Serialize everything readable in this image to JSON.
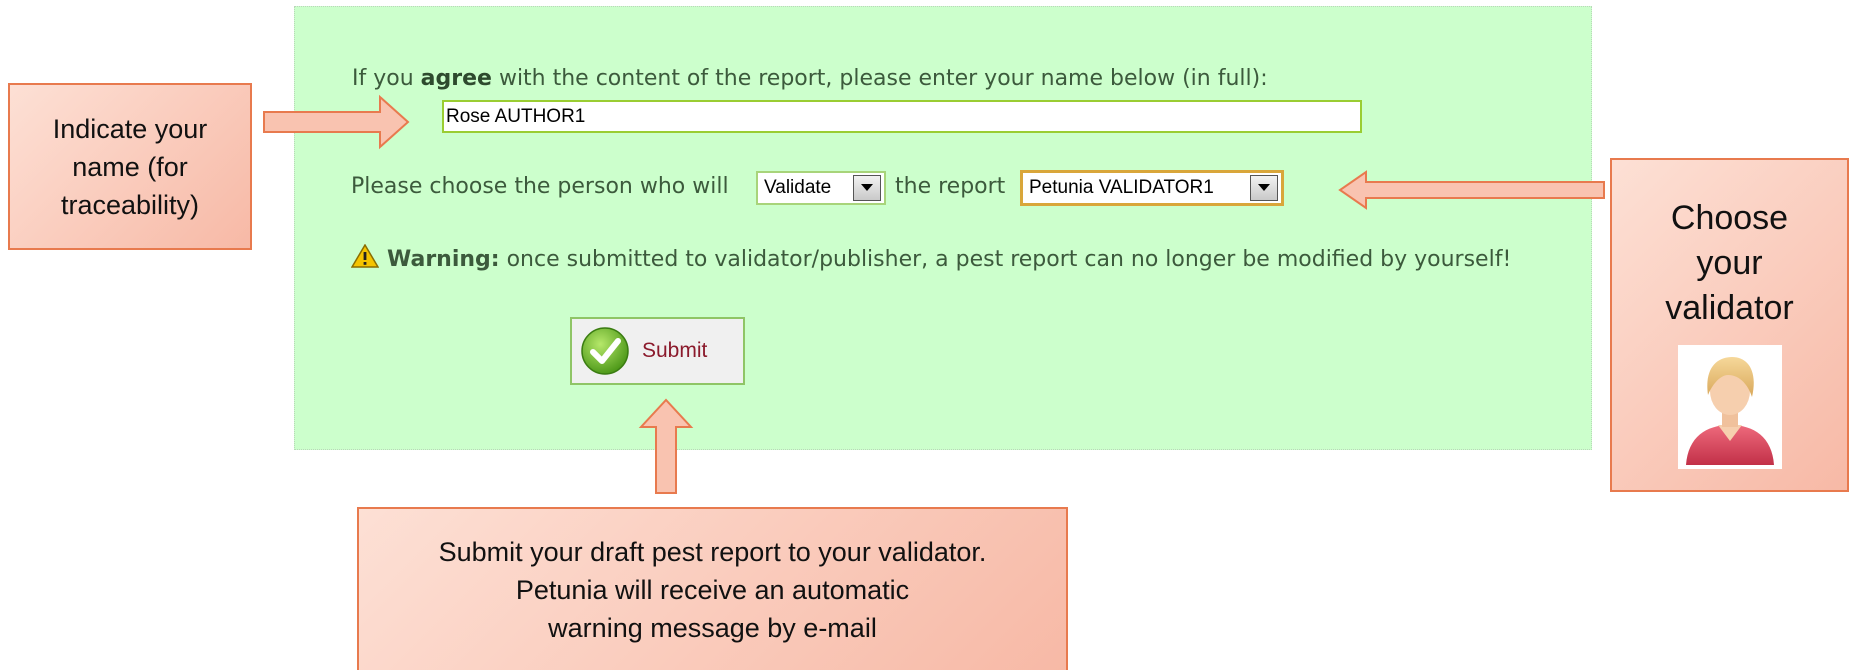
{
  "form": {
    "agree_prefix": "If you ",
    "agree_bold": "agree",
    "agree_suffix": " with the content of the report, please enter your name below (in full):",
    "name_value": "Rose AUTHOR1",
    "choose_prefix": "Please choose the person who will",
    "action_selected": "Validate",
    "choose_middle": "the report",
    "person_selected": "Petunia VALIDATOR1",
    "warning_label": "Warning:",
    "warning_text": " once submitted to validator/publisher, a pest report can no longer be modified by yourself!",
    "submit_label": "Submit"
  },
  "callouts": {
    "name_hint": "Indicate your\nname (for\ntraceability)",
    "validator_hint": "Choose\nyour\nvalidator",
    "submit_hint": "Submit your draft pest report to your validator.\nPetunia will receive an automatic\nwarning message by e-mail"
  },
  "icons": {
    "warning": "warning-triangle-icon",
    "checkmark": "green-checkmark-icon",
    "user": "user-avatar-icon",
    "dropdown": "dropdown-arrow-icon"
  },
  "colors": {
    "panel_bg": "#ccffcc",
    "text": "#3c5a3c",
    "submit_text": "#8b1a2c",
    "callout_border": "#e87a4e",
    "callout_fill": "#f7b9a6",
    "field_border": "#9acd32"
  }
}
